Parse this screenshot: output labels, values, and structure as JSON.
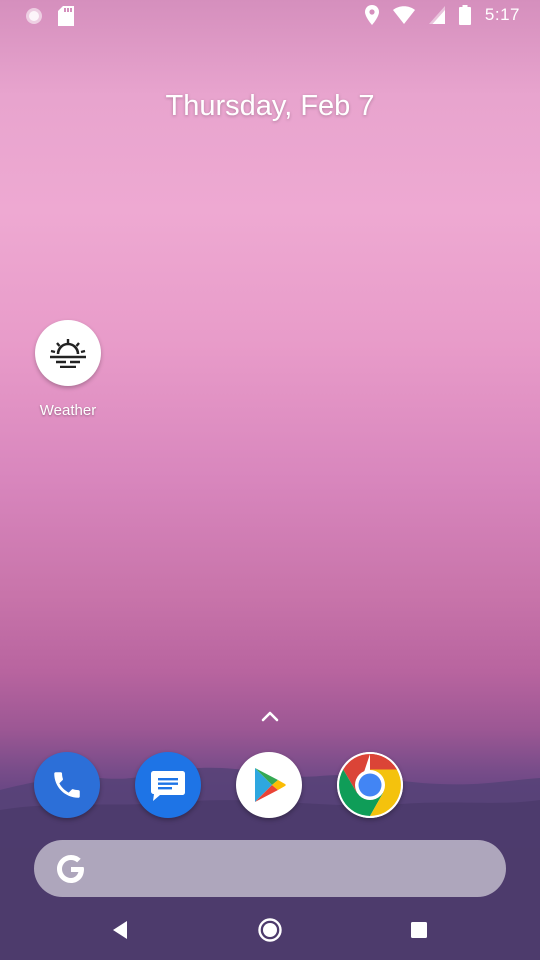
{
  "status_bar": {
    "time": "5:17",
    "icons_left": [
      "notification-dot-icon",
      "sd-card-icon"
    ],
    "icons_right": [
      "location-icon",
      "wifi-icon",
      "cell-signal-icon",
      "battery-icon"
    ]
  },
  "home": {
    "date": "Thursday, Feb 7",
    "apps": [
      {
        "label": "Weather",
        "icon": "weather-sunrise-icon"
      }
    ]
  },
  "dock": {
    "drawer_icon": "chevron-up-icon",
    "apps": [
      {
        "name": "Phone",
        "icon": "phone-icon",
        "color": "#2c6fd8"
      },
      {
        "name": "Messages",
        "icon": "messages-icon",
        "color": "#1e74e6"
      },
      {
        "name": "Play Store",
        "icon": "play-store-icon",
        "color": "#ffffff"
      },
      {
        "name": "Chrome",
        "icon": "chrome-icon",
        "color": "#ffffff"
      }
    ]
  },
  "search_bar": {
    "icon": "google-g-icon"
  },
  "nav_bar": {
    "buttons": [
      "back-icon",
      "home-icon",
      "recents-icon"
    ]
  },
  "colors": {
    "wallpaper_top": "#eea9d2",
    "wallpaper_bottom": "#4a3a6d",
    "search_bar": "#c9b8d2"
  }
}
